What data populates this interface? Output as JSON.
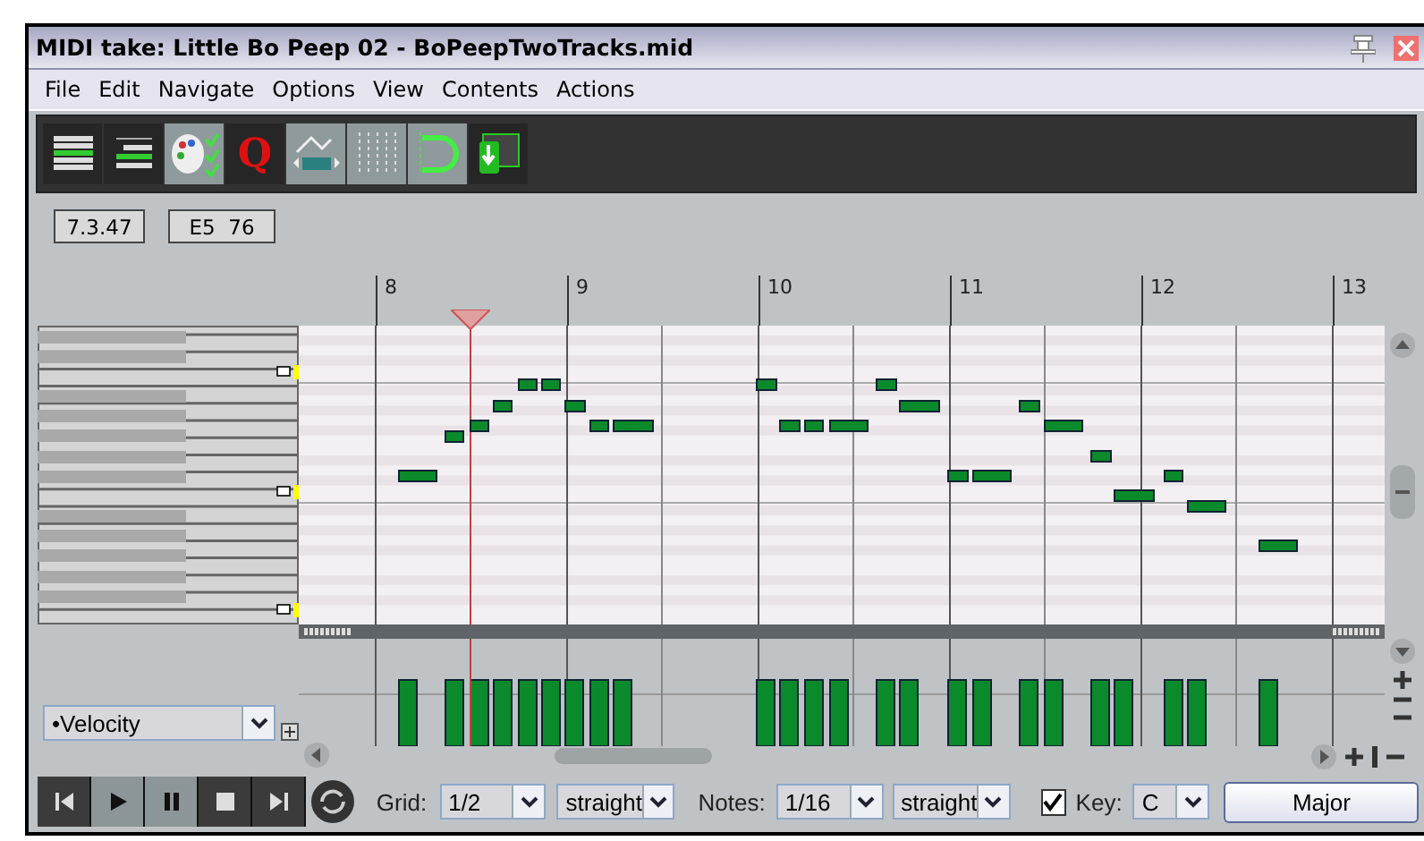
{
  "window": {
    "title": "MIDI take: Little Bo Peep 02 - BoPeepTwoTracks.mid"
  },
  "menu": [
    "File",
    "Edit",
    "Navigate",
    "Options",
    "View",
    "Contents",
    "Actions"
  ],
  "toolbar": [
    {
      "kind": "event-list",
      "on": false
    },
    {
      "kind": "track-list",
      "on": false
    },
    {
      "kind": "palette",
      "on": true
    },
    {
      "kind": "quantize",
      "on": false,
      "glyph": "Q"
    },
    {
      "kind": "cc-curve",
      "on": true
    },
    {
      "kind": "grid",
      "on": true
    },
    {
      "kind": "loop",
      "on": true
    },
    {
      "kind": "insert",
      "on": false
    }
  ],
  "position": {
    "time": "7.3.47",
    "note": "E5  76"
  },
  "ruler": [
    "8",
    "9",
    "10",
    "11",
    "12",
    "13"
  ],
  "lane": {
    "value": "•Velocity"
  },
  "transport": [
    {
      "kind": "start",
      "on": false
    },
    {
      "kind": "play",
      "on": true
    },
    {
      "kind": "pause",
      "on": true
    },
    {
      "kind": "stop",
      "on": false
    },
    {
      "kind": "end",
      "on": false
    }
  ],
  "grid": {
    "label": "Grid:",
    "value": "1/2",
    "swing": "straight"
  },
  "notes": {
    "label": "Notes:",
    "value": "1/16",
    "swing": "straight"
  },
  "key": {
    "label": "Key:",
    "checked": true,
    "value": "C"
  },
  "scale_button": "Major"
}
